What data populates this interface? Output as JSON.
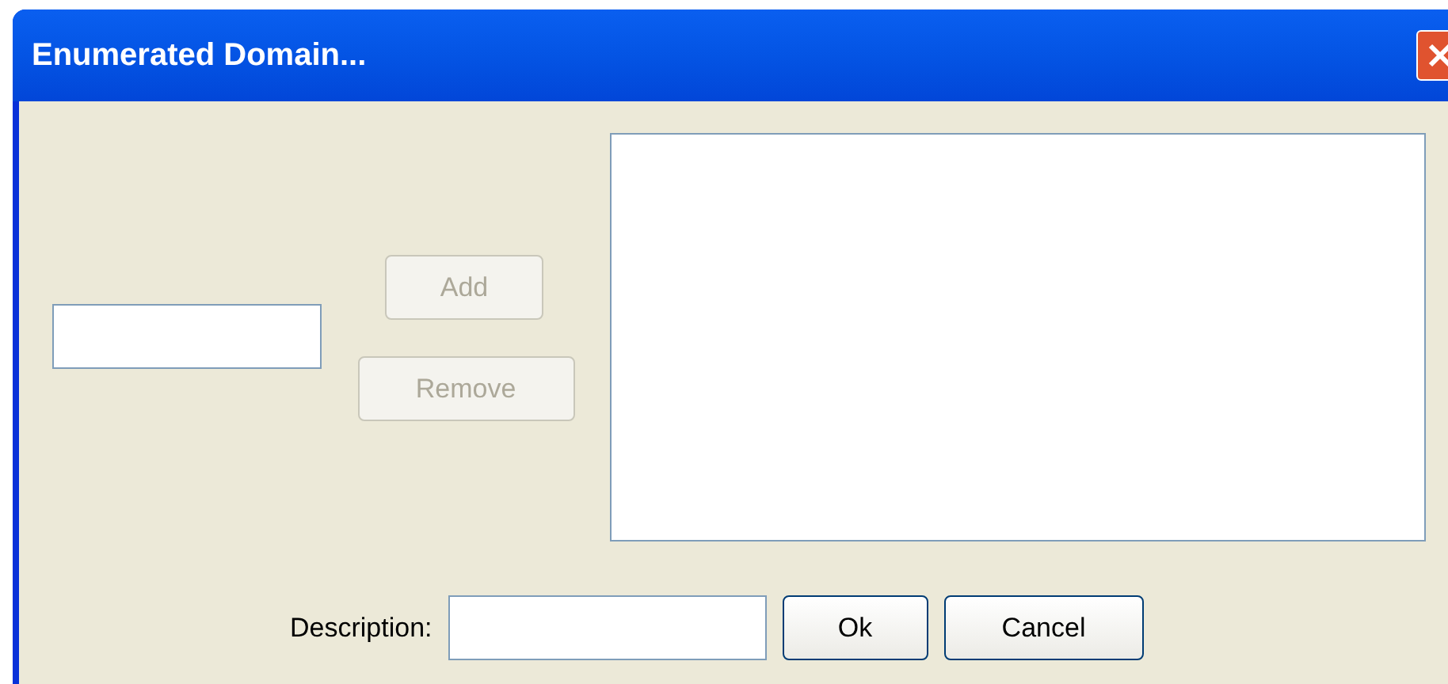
{
  "window": {
    "title": "Enumerated Domain..."
  },
  "buttons": [
    {
      "label": "Add",
      "disabled": true
    },
    {
      "label": "Remove",
      "disabled": true
    }
  ],
  "description": {
    "label": "Description:"
  },
  "footer_buttons": [
    {
      "label": "Ok",
      "disabled": false
    },
    {
      "label": "Cancel",
      "disabled": false
    }
  ]
}
